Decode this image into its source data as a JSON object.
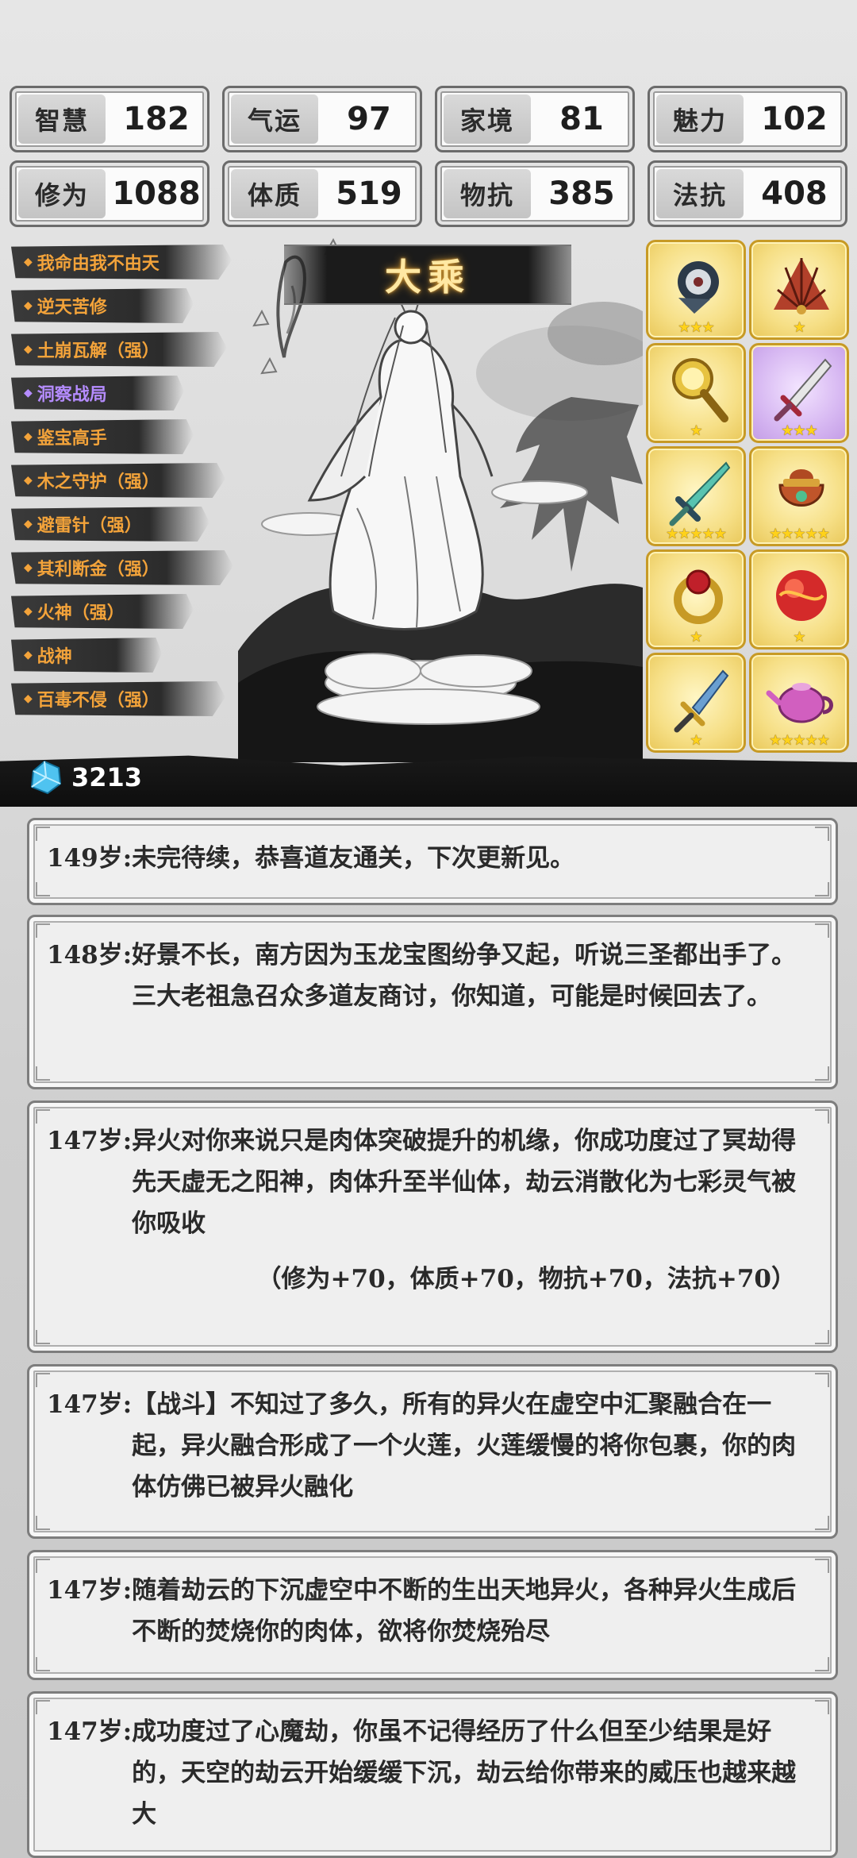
{
  "stats": [
    {
      "label": "智慧",
      "value": "182"
    },
    {
      "label": "气运",
      "value": "97"
    },
    {
      "label": "家境",
      "value": "81"
    },
    {
      "label": "魅力",
      "value": "102"
    },
    {
      "label": "修为",
      "value": "1088"
    },
    {
      "label": "体质",
      "value": "519"
    },
    {
      "label": "物抗",
      "value": "385"
    },
    {
      "label": "法抗",
      "value": "408"
    }
  ],
  "skills": [
    {
      "label": "我命由我不由天",
      "color": "#f3a33a"
    },
    {
      "label": "逆天苦修",
      "color": "#f3a33a"
    },
    {
      "label": "土崩瓦解（强）",
      "color": "#f3a33a"
    },
    {
      "label": "洞察战局",
      "color": "#b58cff"
    },
    {
      "label": "鉴宝高手",
      "color": "#f3a33a"
    },
    {
      "label": "木之守护（强）",
      "color": "#f3a33a"
    },
    {
      "label": "避雷针（强）",
      "color": "#f3a33a"
    },
    {
      "label": "其利断金（强）",
      "color": "#f3a33a"
    },
    {
      "label": "火神（强）",
      "color": "#f3a33a"
    },
    {
      "label": "战神",
      "color": "#f3a33a"
    },
    {
      "label": "百毒不侵（强）",
      "color": "#f3a33a"
    }
  ],
  "realm": "大乘",
  "equipment": [
    {
      "icon": "gauntlet-icon",
      "stars": 3,
      "rarity": "gold"
    },
    {
      "icon": "fan-icon",
      "stars": 1,
      "rarity": "gold"
    },
    {
      "icon": "hand-mirror-icon",
      "stars": 1,
      "rarity": "gold"
    },
    {
      "icon": "sword-icon",
      "stars": 3,
      "rarity": "purple"
    },
    {
      "icon": "jade-sword-icon",
      "stars": 5,
      "rarity": "gold"
    },
    {
      "icon": "cauldron-icon",
      "stars": 5,
      "rarity": "gold"
    },
    {
      "icon": "ring-icon",
      "stars": 1,
      "rarity": "gold"
    },
    {
      "icon": "fire-orb-icon",
      "stars": 1,
      "rarity": "gold"
    },
    {
      "icon": "dagger-icon",
      "stars": 1,
      "rarity": "gold"
    },
    {
      "icon": "teapot-icon",
      "stars": 5,
      "rarity": "gold"
    }
  ],
  "currency": {
    "icon": "spirit-stone-icon",
    "amount": "3213"
  },
  "log": [
    {
      "age": "149岁:",
      "text": "未完待续，恭喜道友通关，下次更新见。"
    },
    {
      "age": "148岁:",
      "text": "好景不长，南方因为玉龙宝图纷争又起，听说三圣都出手了。三大老祖急召众多道友商讨，你知道，可能是时候回去了。"
    },
    {
      "age": "147岁:",
      "text": "异火对你来说只是肉体突破提升的机缘，你成功度过了冥劫得先天虚无之阳神，肉体升至半仙体，劫云消散化为七彩灵气被你吸收",
      "bonus": "（修为+70，体质+70，物抗+70，法抗+70）"
    },
    {
      "age": "147岁:",
      "text": "【战斗】不知过了多久，所有的异火在虚空中汇聚融合在一起，异火融合形成了一个火莲，火莲缓慢的将你包裹，你的肉体仿佛已被异火融化"
    },
    {
      "age": "147岁:",
      "text": "随着劫云的下沉虚空中不断的生出天地异火，各种异火生成后不断的焚烧你的肉体，欲将你焚烧殆尽"
    },
    {
      "age": "147岁:",
      "text": "成功度过了心魔劫，你虽不记得经历了什么但至少结果是好的，天空的劫云开始缓缓下沉，劫云给你带来的威压也越来越大"
    }
  ]
}
